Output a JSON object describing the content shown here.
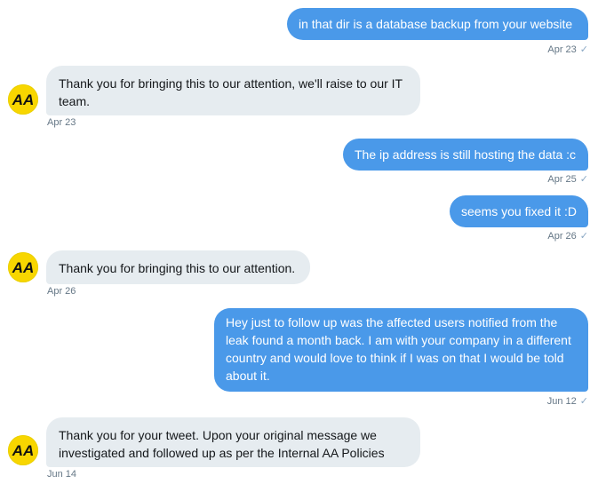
{
  "brand": {
    "avatar_text": "AA",
    "avatar_color": "#f8d600"
  },
  "messages": [
    {
      "from": "user",
      "text": "in that dir is a database backup from your website",
      "date": "Apr 23"
    },
    {
      "from": "aa",
      "text": "Thank you for bringing this to our attention, we'll raise to our IT\nteam.",
      "date": "Apr 23"
    },
    {
      "from": "user",
      "text": "The ip address is still hosting the data :c",
      "date": "Apr 25"
    },
    {
      "from": "user",
      "text": "seems you fixed it :D",
      "date": "Apr 26"
    },
    {
      "from": "aa",
      "text": "Thank you for bringing this to our attention.",
      "date": "Apr 26"
    },
    {
      "from": "user",
      "text": "Hey just to follow up was the affected users notified from the\nleak found a month back. I am with your company in a different\ncountry and would love to think if I was on that I would be told\nabout it.",
      "date": "Jun 12"
    },
    {
      "from": "aa",
      "text": "Thank you for your tweet. Upon your original message we\ninvestigated and followed up as per the Internal AA Policies",
      "date": "Jun 14"
    }
  ],
  "colors": {
    "sent_bubble": "#4a99e9",
    "received_bubble": "#e6ecf0",
    "meta_text": "#657786"
  }
}
